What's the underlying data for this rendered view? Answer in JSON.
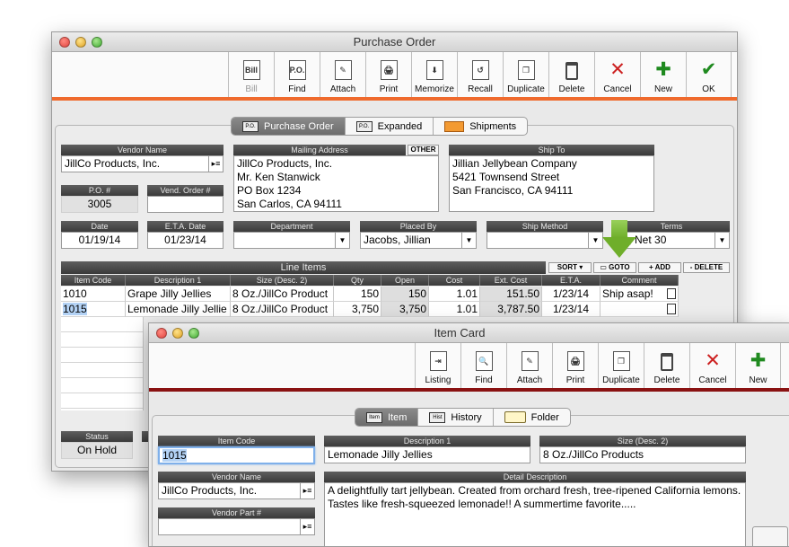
{
  "po_window": {
    "title": "Purchase Order",
    "toolbar": [
      {
        "label": "Bill",
        "icon": "bill-icon",
        "glyph": "Bill",
        "disabled": true
      },
      {
        "label": "Find",
        "icon": "find-icon",
        "glyph": "P.O.",
        "disabled": false
      },
      {
        "label": "Attach",
        "icon": "attach-icon",
        "glyph": "✎",
        "disabled": false
      },
      {
        "label": "Print",
        "icon": "print-icon",
        "glyph": "🖨",
        "disabled": false
      },
      {
        "label": "Memorize",
        "icon": "memorize-icon",
        "glyph": "⬇",
        "disabled": false
      },
      {
        "label": "Recall",
        "icon": "recall-icon",
        "glyph": "↺",
        "disabled": false
      },
      {
        "label": "Duplicate",
        "icon": "duplicate-icon",
        "glyph": "❐",
        "disabled": false
      },
      {
        "label": "Delete",
        "icon": "trash-icon",
        "glyph": "",
        "disabled": false
      },
      {
        "label": "Cancel",
        "icon": "cancel-icon",
        "glyph": "✕",
        "disabled": false
      },
      {
        "label": "New",
        "icon": "new-icon",
        "glyph": "✚",
        "disabled": false
      },
      {
        "label": "OK",
        "icon": "ok-icon",
        "glyph": "✔",
        "disabled": false
      }
    ],
    "tabs": {
      "purchase_order": "Purchase Order",
      "expanded": "Expanded",
      "shipments": "Shipments"
    },
    "tab_badge": "P.O.",
    "labels": {
      "vendor_name": "Vendor Name",
      "mailing_address": "Mailing Address",
      "other": "OTHER",
      "ship_to": "Ship To",
      "po_number": "P.O. #",
      "vend_order": "Vend. Order #",
      "date": "Date",
      "eta_date": "E.T.A. Date",
      "department": "Department",
      "placed_by": "Placed By",
      "ship_method": "Ship Method",
      "terms": "Terms",
      "line_items": "Line Items",
      "status": "Status"
    },
    "values": {
      "vendor_name": "JillCo Products, Inc.",
      "mailing_address": [
        "JillCo Products, Inc.",
        "Mr. Ken Stanwick",
        "PO Box 1234",
        "San Carlos, CA  94111"
      ],
      "ship_to": [
        "Jillian Jellybean Company",
        "5421 Townsend Street",
        "San Francisco, CA  94111"
      ],
      "po_number": "3005",
      "vend_order": "",
      "date": "01/19/14",
      "eta_date": "01/23/14",
      "department": "",
      "placed_by": "Jacobs, Jillian",
      "ship_method": "",
      "terms": "10, Net 30",
      "status": "On Hold"
    },
    "line_buttons": {
      "sort": "SORT ▾",
      "goto": "GOTO",
      "add": "+ ADD",
      "delete": "- DELETE"
    },
    "columns": [
      "Item Code",
      "Description 1",
      "Size (Desc. 2)",
      "Qty",
      "Open",
      "Cost",
      "Ext. Cost",
      "E.T.A.",
      "Comment"
    ],
    "rows": [
      {
        "item_code": "1010",
        "desc": "Grape Jilly Jellies",
        "size": "8 Oz./JillCo Product",
        "qty": "150",
        "open": "150",
        "cost": "1.01",
        "ext": "151.50",
        "eta": "1/23/14",
        "comment": "Ship asap!"
      },
      {
        "item_code": "1015",
        "desc": "Lemonade Jilly Jellie",
        "size": "8 Oz./JillCo Product",
        "qty": "3,750",
        "open": "3,750",
        "cost": "1.01",
        "ext": "3,787.50",
        "eta": "1/23/14",
        "comment": ""
      }
    ]
  },
  "item_window": {
    "title": "Item Card",
    "toolbar": [
      {
        "label": "Listing",
        "icon": "listing-icon",
        "glyph": "⇥"
      },
      {
        "label": "Find",
        "icon": "find-icon",
        "glyph": "🔍"
      },
      {
        "label": "Attach",
        "icon": "attach-icon",
        "glyph": "✎"
      },
      {
        "label": "Print",
        "icon": "print-icon",
        "glyph": "🖨"
      },
      {
        "label": "Duplicate",
        "icon": "duplicate-icon",
        "glyph": "❐"
      },
      {
        "label": "Delete",
        "icon": "trash-icon",
        "glyph": ""
      },
      {
        "label": "Cancel",
        "icon": "cancel-icon",
        "glyph": "✕"
      },
      {
        "label": "New",
        "icon": "new-icon",
        "glyph": "✚"
      }
    ],
    "tabs": {
      "item": "Item",
      "history": "History",
      "folder": "Folder"
    },
    "tab_badges": {
      "item": "Item",
      "history": "Hist"
    },
    "labels": {
      "item_code": "Item Code",
      "description1": "Description 1",
      "size": "Size (Desc. 2)",
      "vendor_name": "Vendor Name",
      "detail_description": "Detail Description",
      "vendor_part": "Vendor Part #"
    },
    "values": {
      "item_code": "1015",
      "description1": "Lemonade Jilly Jellies",
      "size": "8 Oz./JillCo Products",
      "vendor_name": "JillCo Products, Inc.",
      "detail_description": "A delightfully tart jellybean. Created from orchard fresh, tree-ripened California lemons. Tastes like fresh-squeezed lemonade!! A summertime favorite.....",
      "vendor_part": ""
    }
  },
  "colors": {
    "accent_orange": "#ef6a2d",
    "accent_dark_red": "#8a1212",
    "drag_arrow": "#6fae2a"
  }
}
